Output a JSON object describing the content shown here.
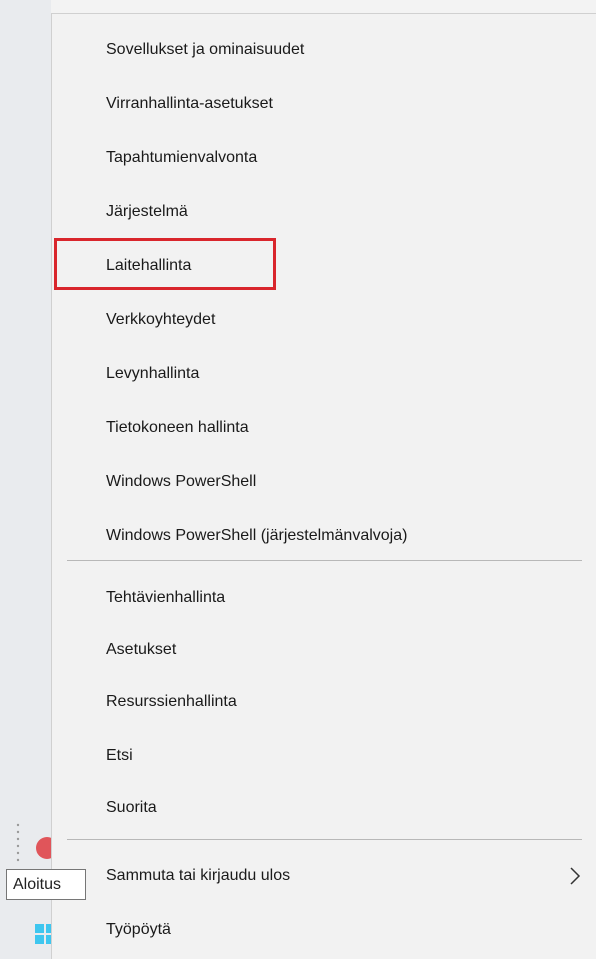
{
  "menu": {
    "items_group1": [
      {
        "label": "Sovellukset ja ominaisuudet"
      },
      {
        "label": "Virranhallinta-asetukset"
      },
      {
        "label": "Tapahtumienvalvonta"
      },
      {
        "label": "Järjestelmä"
      },
      {
        "label": "Laitehallinta"
      },
      {
        "label": "Verkkoyhteydet"
      },
      {
        "label": "Levynhallinta"
      },
      {
        "label": "Tietokoneen hallinta"
      },
      {
        "label": "Windows PowerShell"
      },
      {
        "label": "Windows PowerShell (järjestelmänvalvoja)"
      }
    ],
    "items_group2": [
      {
        "label": "Tehtävienhallinta"
      },
      {
        "label": "Asetukset"
      },
      {
        "label": "Resurssienhallinta"
      },
      {
        "label": "Etsi"
      },
      {
        "label": "Suorita"
      }
    ],
    "items_group3": [
      {
        "label": "Sammuta tai kirjaudu ulos",
        "submenu_icon": "chevron-right-icon"
      },
      {
        "label": "Työpöytä"
      }
    ],
    "highlighted_item": "Laitehallinta",
    "highlight_color": "#d9262c"
  },
  "taskbar": {
    "tooltip": "Aloitus",
    "start_icon": "windows-logo-icon",
    "closed_app_icon": "close-circle-icon"
  }
}
